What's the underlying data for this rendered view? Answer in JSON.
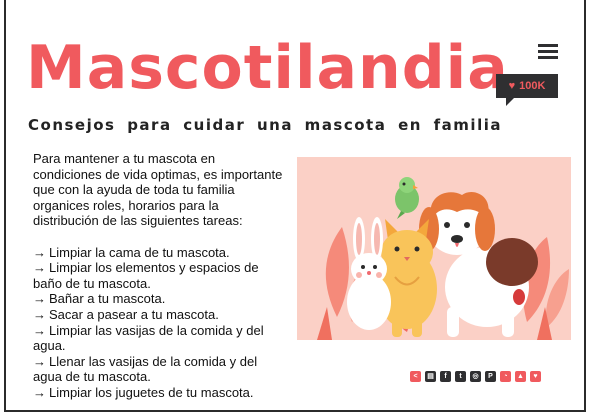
{
  "site": {
    "title": "Mascotilandia",
    "likes": "100K",
    "subtitle": "Consejos para cuidar una mascota en familia"
  },
  "content": {
    "intro": "Para mantener a tu mascota en condiciones de vida optimas,  es importante que con la ayuda de toda tu familia organices roles, horarios para la distribución de las siguientes tareas:",
    "arrow": "→",
    "tasks": [
      "Limpiar la cama de tu mascota.",
      "Limpiar los elementos  y espacios de baño de tu mascota.",
      "Bañar a tu mascota.",
      "Sacar a pasear a tu mascota.",
      "Limpiar las vasijas de la comida y del agua.",
      "Llenar las vasijas de la comida y del agua de tu mascota.",
      "Limpiar los juguetes de tu mascota."
    ]
  },
  "icons": {
    "menu": "hamburger-menu-icon",
    "like": "heart-icon",
    "social": [
      "share-icon",
      "print-icon",
      "facebook-icon",
      "twitter-icon",
      "instagram-icon",
      "pinterest-icon",
      "rss-icon",
      "like-icon",
      "favorite-icon"
    ]
  },
  "colors": {
    "brand": "#f05a5e",
    "dark": "#2f2f31",
    "hero_bg": "#fbd0c6"
  }
}
